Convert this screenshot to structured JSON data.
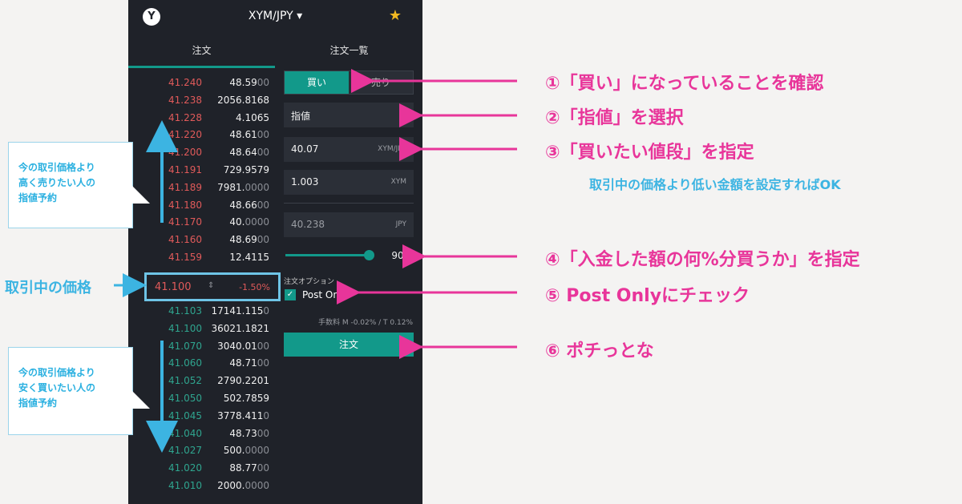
{
  "header": {
    "logo": "Y",
    "pair": "XYM/JPY ▾",
    "star": "★"
  },
  "tabs": {
    "order": "注文",
    "list": "注文一覧"
  },
  "asks": [
    {
      "price": "41.240",
      "qty_main": "48.59",
      "qty_dim": "00"
    },
    {
      "price": "41.238",
      "qty_main": "2056.8168",
      "qty_dim": ""
    },
    {
      "price": "41.228",
      "qty_main": "4.1065",
      "qty_dim": ""
    },
    {
      "price": "41.220",
      "qty_main": "48.61",
      "qty_dim": "00"
    },
    {
      "price": "41.200",
      "qty_main": "48.64",
      "qty_dim": "00"
    },
    {
      "price": "41.191",
      "qty_main": "729.9579",
      "qty_dim": ""
    },
    {
      "price": "41.189",
      "qty_main": "7981.",
      "qty_dim": "0000"
    },
    {
      "price": "41.180",
      "qty_main": "48.66",
      "qty_dim": "00"
    },
    {
      "price": "41.170",
      "qty_main": "40.",
      "qty_dim": "0000"
    },
    {
      "price": "41.160",
      "qty_main": "48.69",
      "qty_dim": "00"
    },
    {
      "price": "41.159",
      "qty_main": "12.4115",
      "qty_dim": ""
    }
  ],
  "mid": {
    "price": "41.100",
    "updown": "⇕",
    "change": "-1.50%"
  },
  "bids": [
    {
      "price": "41.103",
      "qty_main": "17141.115",
      "qty_dim": "0"
    },
    {
      "price": "41.100",
      "qty_main": "36021.1821",
      "qty_dim": ""
    },
    {
      "price": "41.070",
      "qty_main": "3040.01",
      "qty_dim": "00"
    },
    {
      "price": "41.060",
      "qty_main": "48.71",
      "qty_dim": "00"
    },
    {
      "price": "41.052",
      "qty_main": "2790.2201",
      "qty_dim": ""
    },
    {
      "price": "41.050",
      "qty_main": "502.7859",
      "qty_dim": ""
    },
    {
      "price": "41.045",
      "qty_main": "3778.411",
      "qty_dim": "0"
    },
    {
      "price": "41.040",
      "qty_main": "48.73",
      "qty_dim": "00"
    },
    {
      "price": "41.027",
      "qty_main": "500.",
      "qty_dim": "0000"
    },
    {
      "price": "41.020",
      "qty_main": "88.77",
      "qty_dim": "00"
    },
    {
      "price": "41.010",
      "qty_main": "2000.",
      "qty_dim": "0000"
    }
  ],
  "form": {
    "buy": "買い",
    "sell": "売り",
    "order_type": "指値",
    "price_value": "40.07",
    "price_unit": "XYM/JPY",
    "amount_value": "1.003",
    "amount_unit": "XYM",
    "total_value": "40.238",
    "total_unit": "JPY",
    "slider_pct": 90,
    "slider_label": "90%",
    "option_label": "注文オプション",
    "post_only": "Post Only",
    "post_only_checked": true,
    "fee": "手数料 M -0.02% / T 0.12%",
    "submit": "注文"
  },
  "annotations": {
    "sell_note": [
      "今の取引価格より",
      "高く売りたい人の",
      "指値予約"
    ],
    "buy_note": [
      "今の取引価格より",
      "安く買いたい人の",
      "指値予約"
    ],
    "mid_label": "取引中の価格",
    "step1": "①「買い」になっていることを確認",
    "step2": "②「指値」を選択",
    "step3": "③「買いたい値段」を指定",
    "step3_sub": "取引中の価格より低い金額を設定すればOK",
    "step4": "④「入金した額の何%分買うか」を指定",
    "step5": "⑤ Post Onlyにチェック",
    "step6": "⑥ ポチっとな"
  },
  "colors": {
    "accent": "#12998a",
    "ask": "#e05a5a",
    "bid": "#2fa58f",
    "annotation_pink": "#e8359a",
    "annotation_blue": "#3cb4e2"
  }
}
